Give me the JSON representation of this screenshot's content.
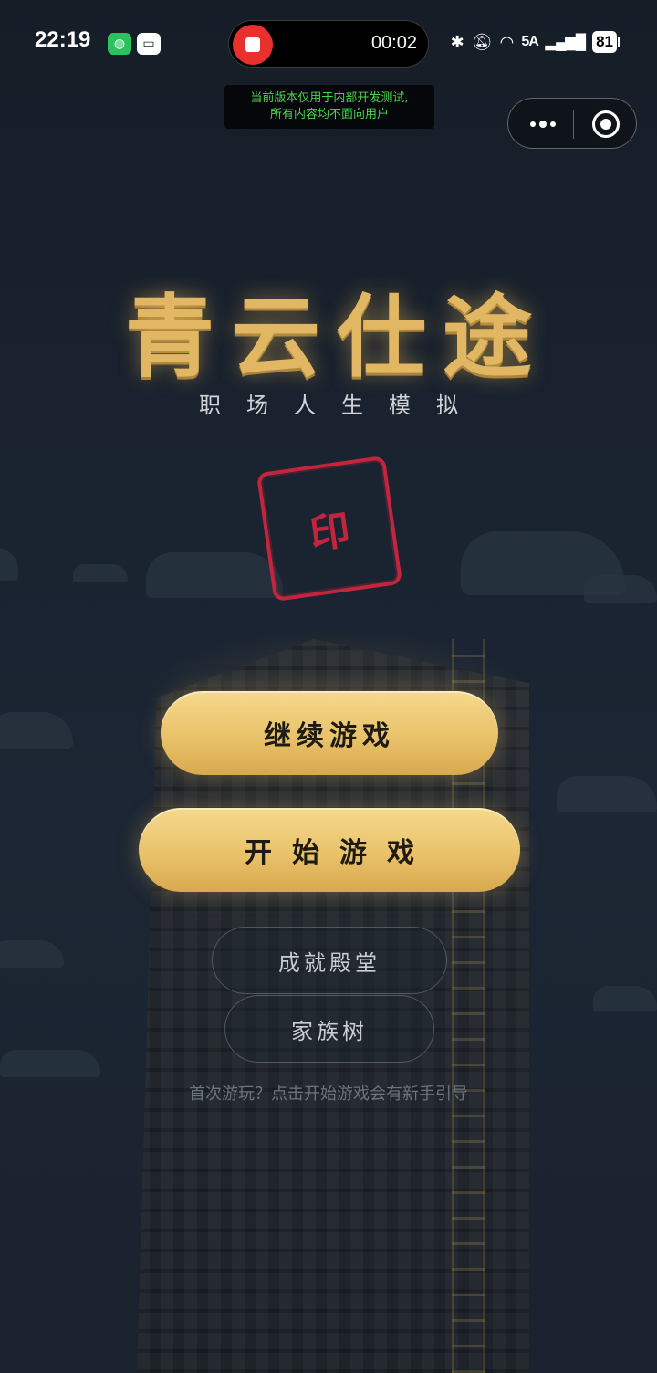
{
  "status_bar": {
    "time": "22:19",
    "recording_time": "00:02",
    "network": "5A",
    "battery": "81"
  },
  "dev_notice": {
    "line1": "当前版本仅用于内部开发测试,",
    "line2": "所有内容均不面向用户"
  },
  "header": {
    "title": "青云仕途",
    "subtitle": "职场人生模拟"
  },
  "seal": {
    "text": "印",
    "color": "#c5243e"
  },
  "menu": {
    "continue_label": "继续游戏",
    "start_label": "开始游戏",
    "achievements_label": "成就殿堂",
    "family_tree_label": "家族树"
  },
  "hint": "首次游玩？点击开始游戏会有新手引导",
  "colors": {
    "gold": "#e2b763",
    "background": "#1a2330"
  }
}
